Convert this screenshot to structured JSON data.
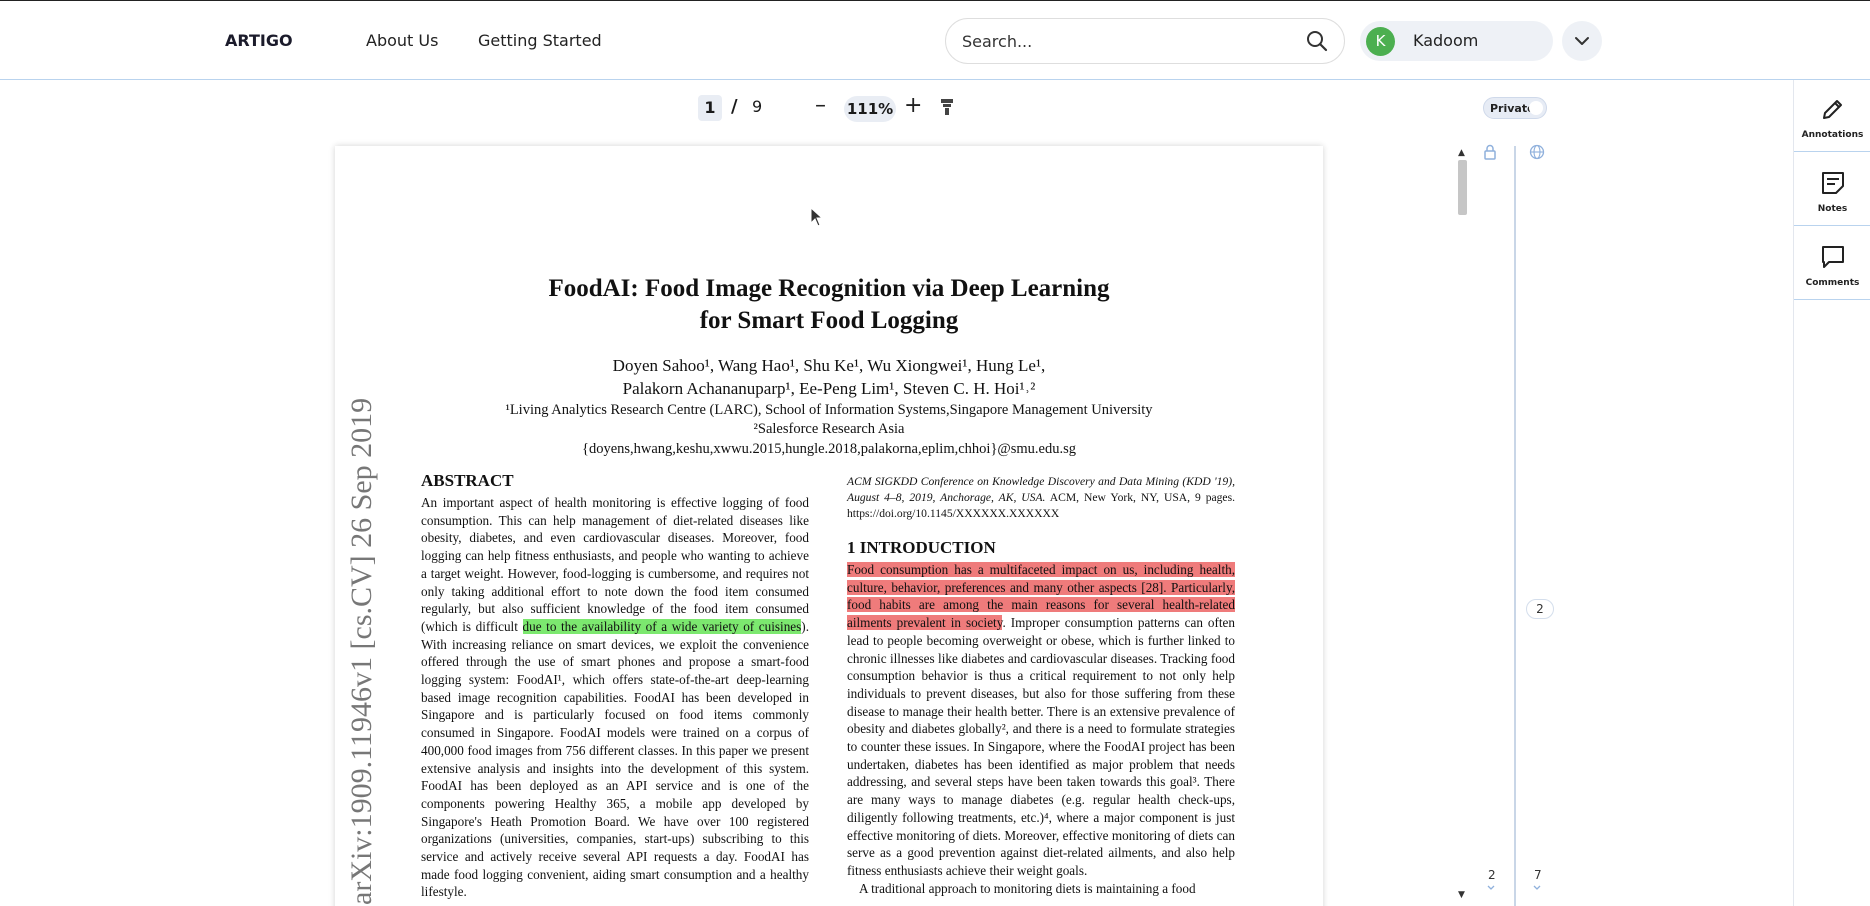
{
  "header": {
    "brand": "ARTIGO",
    "nav": [
      "About Us",
      "Getting Started"
    ],
    "search_placeholder": "Search...",
    "user_initial": "K",
    "user_name": "Kadoom"
  },
  "viewer": {
    "current_page": "1",
    "separator": "/",
    "total_pages": "9",
    "zoom_out": "–",
    "zoom": "111%",
    "zoom_in": "+",
    "privacy_label": "Private"
  },
  "paper": {
    "title_line1": "FoodAI: Food Image Recognition via Deep Learning",
    "title_line2": "for Smart Food Logging",
    "authors_line1": "Doyen Sahoo¹, Wang Hao¹, Shu Ke¹, Wu Xiongwei¹, Hung Le¹,",
    "authors_line2": "Palakorn Achananuparp¹, Ee-Peng Lim¹, Steven C. H. Hoi¹˒²",
    "affil1": "¹Living Analytics Research Centre (LARC), School of Information Systems,Singapore Management University",
    "affil2": "²Salesforce Research Asia",
    "emails": "{doyens,hwang,keshu,xwwu.2015,hungle.2018,palakorna,eplim,chhoi}@smu.edu.sg",
    "arxiv_stamp": "arXiv:1909.11946v1  [cs.CV]  26 Sep 2019",
    "abstract_heading": "ABSTRACT",
    "abstract_pre": "An important aspect of health monitoring is effective logging of food consumption. This can help management of diet-related diseases like obesity, diabetes, and even cardiovascular diseases. Moreover, food logging can help fitness enthusiasts, and people who wanting to achieve a target weight. However, food-logging is cumbersome, and requires not only taking additional effort to note down the food item consumed regularly, but also sufficient knowledge of the food item consumed (which is difficult ",
    "abstract_highlight": "due to the availability of a wide variety of cuisines",
    "abstract_post": "). With increasing reliance on smart devices, we exploit the convenience offered through the use of smart phones and propose a smart-food logging system: FoodAI¹, which offers state-of-the-art deep-learning based image recognition capabilities. FoodAI has been developed in Singapore and is particularly focused on food items commonly consumed in Singapore. FoodAI models were trained on a corpus of 400,000 food images from 756 different classes. In this paper we present extensive analysis and insights into the development of this system. FoodAI has been deployed as an API service and is one of the components powering Healthy 365, a mobile app developed by Singapore's Heath Promotion Board. We have over 100 registered organizations (universities, companies, start-ups) subscribing to this service and actively receive several API requests a day. FoodAI has made food logging convenient, aiding smart consumption and a healthy lifestyle.",
    "conference_italic": "ACM SIGKDD Conference on Knowledge Discovery and Data Mining (KDD '19), August 4–8, 2019, Anchorage, AK, USA.",
    "conference_rest": " ACM, New York, NY, USA, 9 pages. https://doi.org/10.1145/XXXXXX.XXXXXX",
    "intro_heading": "1    INTRODUCTION",
    "intro_highlight": "Food consumption has a multifaceted impact on us, including health, culture, behavior, preferences and many other aspects [28]. Particularly, food habits are among the main reasons for several health-related ailments prevalent in society",
    "intro_post": ". Improper consumption patterns can often lead to people becoming overweight or obese, which is further linked to chronic illnesses like diabetes and cardiovascular diseases. Tracking food consumption behavior is thus a critical requirement to not only help individuals to prevent diseases, but also for those suffering from these disease to manage their health better. There is an extensive prevalence of obesity and diabetes globally², and there is a need to formulate strategies to counter these issues. In Singapore, where the FoodAI project has been undertaken, diabetes has been identified as major problem that needs addressing, and several steps have been taken towards this goal³. There are many ways to manage diabetes (e.g. regular health check-ups, diligently following treatments, etc.)⁴, where a major component is just effective monitoring of diets. Moreover, effective monitoring of diets can serve as a good prevention against diet-related ailments, and also help fitness enthusiasts achieve their weight goals.",
    "intro_cut": "A traditional approach to monitoring diets is maintaining a food"
  },
  "annotation_rail": {
    "marker_mid": "2",
    "count_left": "2",
    "count_right": "7"
  },
  "right_panel": [
    "Annotations",
    "Notes",
    "Comments"
  ],
  "colors": {
    "green_highlight": "#7ce86f",
    "red_highlight": "#ef7b7b",
    "avatar": "#4caf50"
  }
}
